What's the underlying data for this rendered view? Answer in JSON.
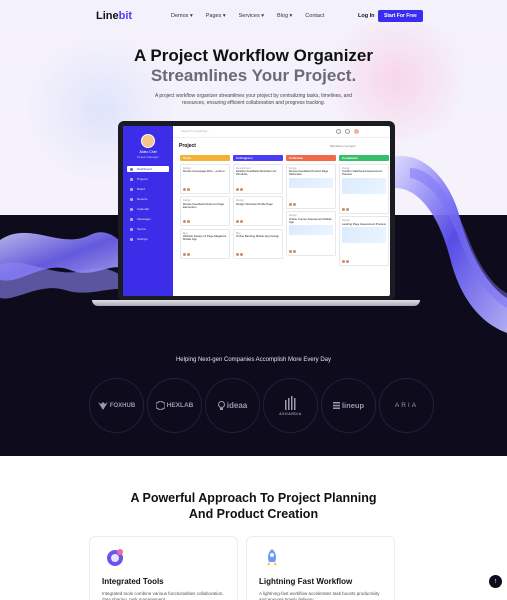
{
  "brand": {
    "line": "Line",
    "bit": "bit"
  },
  "nav": {
    "items": [
      "Demos ▾",
      "Pages ▾",
      "Services ▾",
      "Blog ▾",
      "Contact"
    ],
    "login": "Log In",
    "cta": "Start For Free"
  },
  "hero": {
    "title_line1": "A Project Workflow Organizer",
    "title_line2": "Streamlines Your Project.",
    "subtitle": "A project workflow organizer streamlines your project by centralizing tasks, timelines, and resources, ensuring efficient collaboration and progress tracking."
  },
  "app": {
    "user_name": "Aldeo Chet",
    "user_role": "Project Manager",
    "sidebar": [
      "Dashboard",
      "Projects",
      "Board",
      "Reports",
      "Calendar",
      "Messages",
      "Teams",
      "Settings"
    ],
    "search_placeholder": "Search for anything...",
    "page_title": "Project",
    "members_label": "Members in project",
    "columns": [
      {
        "name": "To Do",
        "color": "#f3b136",
        "cards": [
          {
            "tag": "Design",
            "title": "Revise Homepage Wire... push to"
          },
          {
            "tag": "Design",
            "title": "Revise Feedback Notes for Page Elements's"
          },
          {
            "tag": "Bug",
            "title": "Website Design UI Page Magazine Mobile App"
          }
        ]
      },
      {
        "name": "In Progress",
        "color": "#4a3df5",
        "cards": [
          {
            "tag": "Development",
            "title": "Existing Feedback Illustration for Windows"
          },
          {
            "tag": "Design",
            "title": "Design Windows Profile Page"
          },
          {
            "tag": "Bug",
            "title": "Online Banking Mobile App Design"
          }
        ]
      },
      {
        "name": "In Review",
        "color": "#f06a4a",
        "cards": [
          {
            "tag": "Design",
            "title": "Revise Feedback Product Page Webmaca"
          },
          {
            "tag": "Design",
            "title": "Online Course Assessment Mobile App"
          }
        ]
      },
      {
        "name": "Completed",
        "color": "#34c06a",
        "cards": [
          {
            "tag": "Design",
            "title": "Confirm Dashboard Assessment Preview"
          },
          {
            "tag": "Design",
            "title": "Landing Page Assessment Preview"
          }
        ]
      }
    ]
  },
  "companies": {
    "heading": "Helping Next-gen Companies Accomplish More Every Day",
    "logos": [
      "FOXHUB",
      "HEXLAB",
      "ideaa",
      "ASGARDIA",
      "lineup",
      "ARIA"
    ]
  },
  "section2": {
    "title_line1": "A Powerful Approach To Project Planning",
    "title_line2": "And Product Creation",
    "features": [
      {
        "title": "Integrated Tools",
        "desc": "Integrated tools combine various functionalities collaboration, data sharing, task management"
      },
      {
        "title": "Lightning Fast Workflow",
        "desc": "A lightning-fast workflow accelerates task boosts productivity and ensures timely delivery"
      }
    ]
  },
  "scroll_top": "↑"
}
